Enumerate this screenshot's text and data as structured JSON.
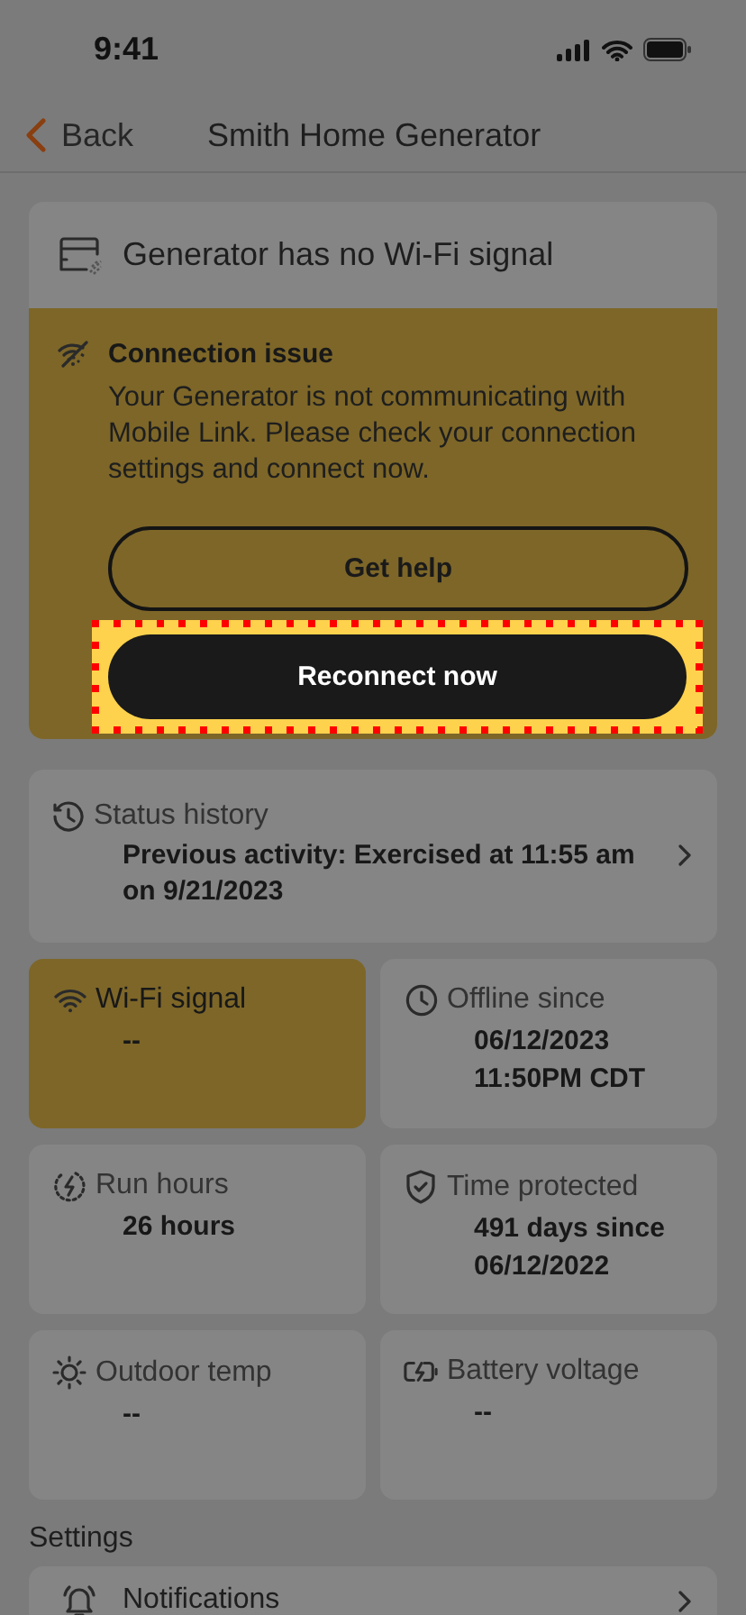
{
  "status_bar": {
    "time": "9:41"
  },
  "nav": {
    "back": "Back",
    "title": "Smith Home Generator"
  },
  "alert": {
    "title": "Generator has no Wi-Fi signal",
    "issue_title": "Connection issue",
    "message": "Your Generator is not communicating with Mobile Link. Please check your connection settings and connect now.",
    "buttons": [
      {
        "label": "Get help",
        "kind": "outline",
        "highlighted": false
      },
      {
        "label": "Reconnect now",
        "kind": "primary",
        "highlighted": true
      }
    ]
  },
  "status_history": {
    "label": "Status history",
    "value": "Previous activity: Exercised at 11:55 am on 9/21/2023"
  },
  "tiles": [
    {
      "label": "Wi-Fi signal",
      "value": "--",
      "alert": true
    },
    {
      "label": "Offline since",
      "value": "06/12/2023\n11:50PM CDT",
      "alert": false
    },
    {
      "label": "Run hours",
      "value": "26 hours",
      "alert": false
    },
    {
      "label": "Time protected",
      "value": "491 days since\n06/12/2022",
      "alert": false
    },
    {
      "label": "Outdoor temp",
      "value": "--",
      "alert": false
    },
    {
      "label": "Battery voltage",
      "value": "--",
      "alert": false
    }
  ],
  "settings": {
    "heading": "Settings",
    "items": [
      {
        "label": "Notifications"
      }
    ]
  }
}
